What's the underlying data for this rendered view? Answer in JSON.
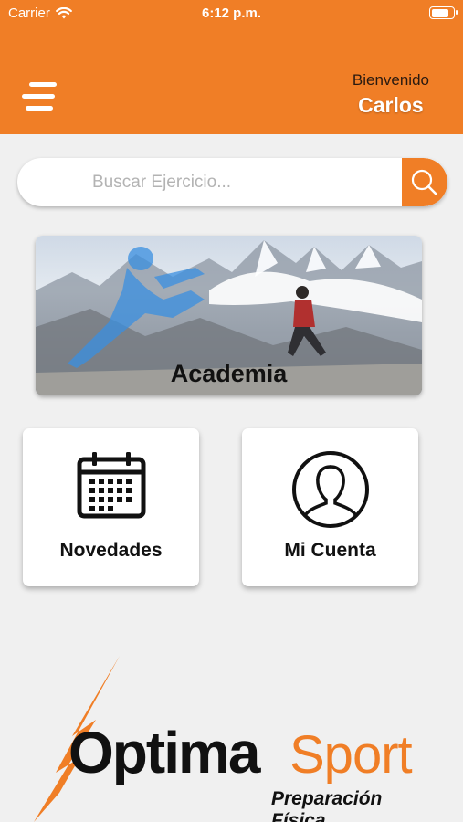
{
  "status_bar": {
    "carrier": "Carrier",
    "time": "6:12 p.m.",
    "battery_level": 0.85
  },
  "header": {
    "menu_icon": "hamburger-menu-icon",
    "welcome_label": "Bienvenido",
    "user_name": "Carlos"
  },
  "search": {
    "placeholder": "Buscar Ejercicio...",
    "value": "",
    "icon": "search-icon"
  },
  "banner": {
    "title": "Academia"
  },
  "cards": [
    {
      "label": "Novedades",
      "icon": "calendar-icon"
    },
    {
      "label": "Mi Cuenta",
      "icon": "user-profile-icon"
    }
  ],
  "logo": {
    "brand_primary": "Optima",
    "brand_secondary": "Sport",
    "tagline": "Preparación Física."
  },
  "colors": {
    "accent": "#f07e26",
    "background": "#f0f0f0",
    "text": "#111111"
  }
}
